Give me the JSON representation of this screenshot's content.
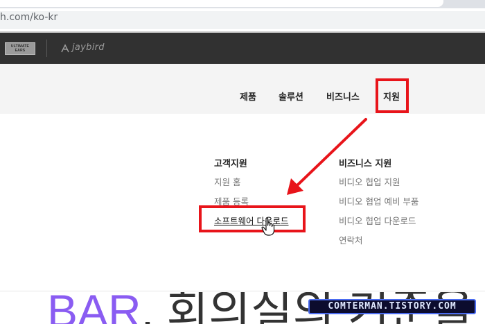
{
  "browser": {
    "url": "h.com/ko-kr"
  },
  "brand": {
    "ue_logo_line1": "ULTIMATE",
    "ue_logo_line2": "EARS",
    "jaybird": "jaybird"
  },
  "nav": {
    "items": [
      "제품",
      "솔루션",
      "비즈니스",
      "지원"
    ]
  },
  "dropdown": {
    "customer": {
      "heading": "고객지원",
      "links": [
        "지원 홈",
        "제품 등록",
        "소프트웨어 다운로드"
      ]
    },
    "business": {
      "heading": "비즈니스 지원",
      "links": [
        "비디오 협업 지원",
        "비디오 협업 예비 부품",
        "비디오 협업 다운로드",
        "연락처"
      ]
    }
  },
  "hero": {
    "accent": "BAR",
    "rest": ", 회의실의 기준을"
  },
  "watermark": "COMTERMAN.TISTORY.COM",
  "colors": {
    "highlight": "#e8141a",
    "hero_accent": "#8a5cf2",
    "brand_bar": "#313131"
  }
}
